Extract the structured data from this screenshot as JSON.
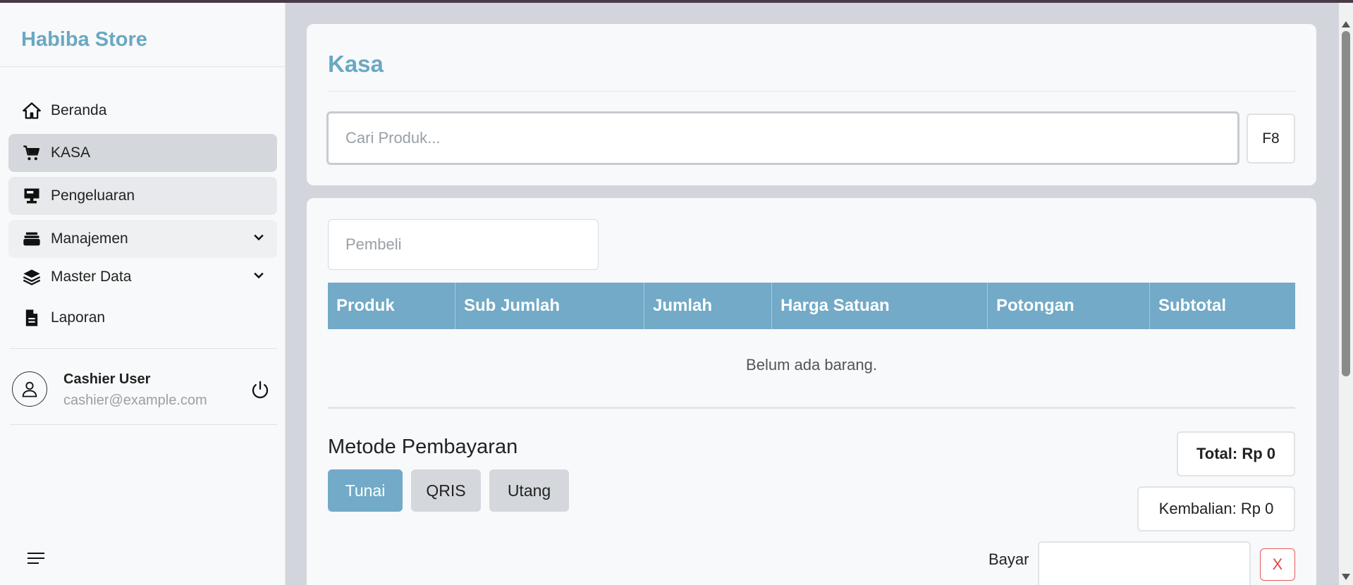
{
  "app": {
    "brand": "Habiba Store"
  },
  "sidebar": {
    "items": [
      {
        "label": "Beranda",
        "icon": "home-icon"
      },
      {
        "label": "KASA",
        "icon": "cart-icon",
        "active": true
      },
      {
        "label": "Pengeluaran",
        "icon": "cash-register-icon"
      },
      {
        "label": "Manajemen",
        "icon": "folder-stack-icon",
        "expandable": true
      },
      {
        "label": "Master Data",
        "icon": "layers-icon",
        "expandable": true
      },
      {
        "label": "Laporan",
        "icon": "document-icon"
      }
    ],
    "user": {
      "name": "Cashier User",
      "email": "cashier@example.com"
    }
  },
  "header": {
    "title": "Kasa"
  },
  "search": {
    "placeholder": "Cari Produk...",
    "shortcut": "F8"
  },
  "buyer": {
    "placeholder": "Pembeli"
  },
  "table": {
    "columns": [
      "Produk",
      "Sub Jumlah",
      "Jumlah",
      "Harga Satuan",
      "Potongan",
      "Subtotal"
    ],
    "empty_message": "Belum ada barang."
  },
  "payment": {
    "title": "Metode Pembayaran",
    "methods": [
      "Tunai",
      "QRIS",
      "Utang"
    ],
    "selected": "Tunai",
    "total_label": "Total: Rp 0",
    "change_label": "Kembalian: Rp 0",
    "pay_label": "Bayar",
    "pay_value": "",
    "clear_label": "X"
  },
  "colors": {
    "accent": "#72aac7",
    "brand": "#6aa8c3",
    "danger": "#e04848"
  }
}
